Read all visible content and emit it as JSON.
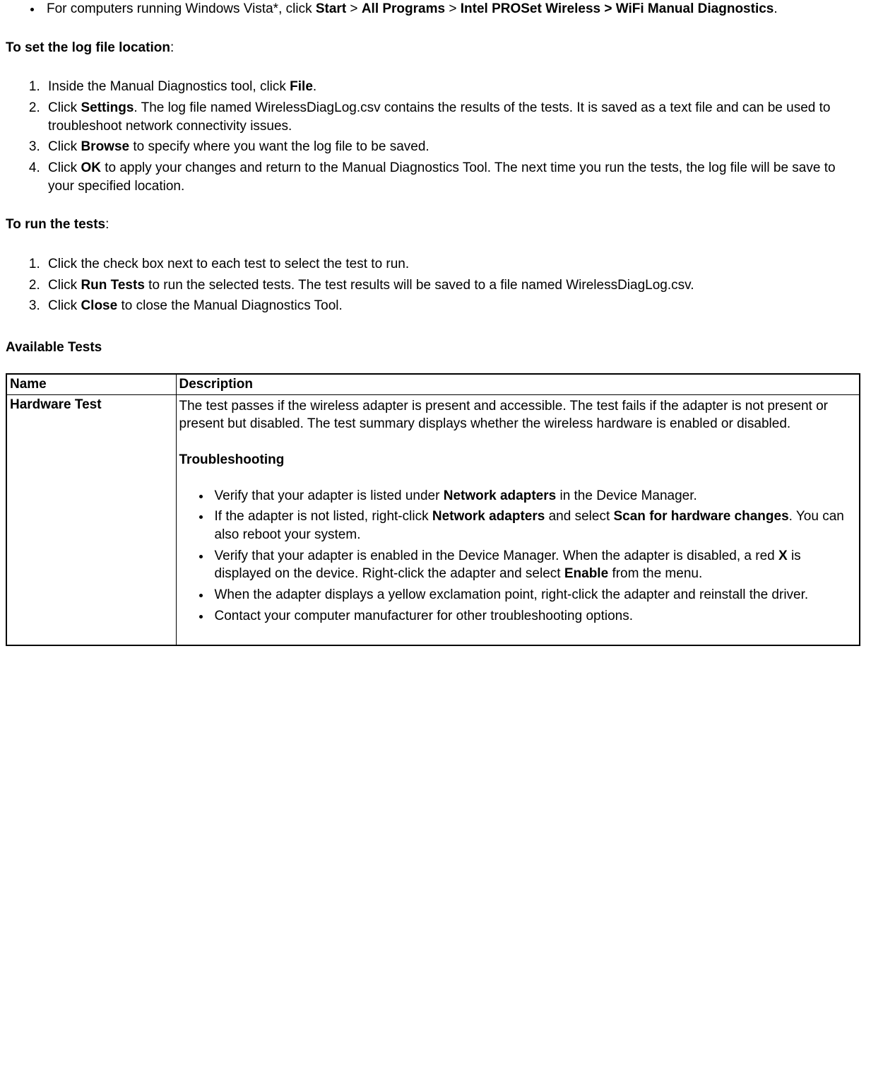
{
  "intro_bullet": {
    "prefix": "For computers running Windows Vista*, click ",
    "b1": "Start",
    "sep1": " > ",
    "b2": "All Programs",
    "sep2": " > ",
    "b3": "Intel PROSet Wireless > WiFi Manual Diagnostics",
    "suffix": "."
  },
  "section1": {
    "lead_bold": "To set the log file location",
    "lead_suffix": ":"
  },
  "ol1": {
    "i1_pre": "Inside the Manual Diagnostics tool, click ",
    "i1_b": "File",
    "i1_post": ".",
    "i2_pre": "Click ",
    "i2_b": "Settings",
    "i2_post": ". The log file named WirelessDiagLog.csv contains the results of the tests. It is saved as a text file and can be used to troubleshoot network connectivity issues.",
    "i3_pre": "Click ",
    "i3_b": "Browse",
    "i3_post": " to specify where you want the log file to be saved.",
    "i4_pre": "Click ",
    "i4_b": "OK",
    "i4_post": " to apply your changes and return to the Manual Diagnostics Tool. The next time you run the tests, the log file will be save to your specified location."
  },
  "section2": {
    "lead_bold": "To run the tests",
    "lead_suffix": ":"
  },
  "ol2": {
    "i1": "Click the check box next to each test to select the test to run.",
    "i2_pre": "Click ",
    "i2_b": "Run Tests",
    "i2_post": " to run the selected tests. The test results will be saved to a file named WirelessDiagLog.csv.",
    "i3_pre": "Click ",
    "i3_b": "Close",
    "i3_post": " to close the Manual Diagnostics Tool."
  },
  "tests_heading": "Available Tests",
  "table": {
    "h1": "Name",
    "h2": "Description",
    "row1": {
      "name": "Hardware Test",
      "desc_p1": "The test passes if the wireless adapter is present and accessible. The test fails if the adapter is not present or present but disabled. The test summary displays whether the wireless hardware is enabled or disabled.",
      "troubleshooting": "Troubleshooting",
      "b1_pre": "Verify that your adapter is listed under ",
      "b1_b": "Network adapters",
      "b1_post": " in the Device Manager.",
      "b2_pre": "If the adapter is not listed, right-click ",
      "b2_b1": "Network adapters",
      "b2_mid": " and select ",
      "b2_b2": "Scan for hardware changes",
      "b2_post": ". You can also reboot your system.",
      "b3_pre": "Verify that your adapter is enabled in the Device Manager. When the adapter is disabled, a red ",
      "b3_b1": "X",
      "b3_mid": " is displayed on the device. Right-click the adapter and select ",
      "b3_b2": "Enable",
      "b3_post": " from the menu.",
      "b4": "When the adapter displays a yellow exclamation point, right-click the adapter and reinstall the driver.",
      "b5": "Contact your computer manufacturer for other troubleshooting options."
    }
  }
}
